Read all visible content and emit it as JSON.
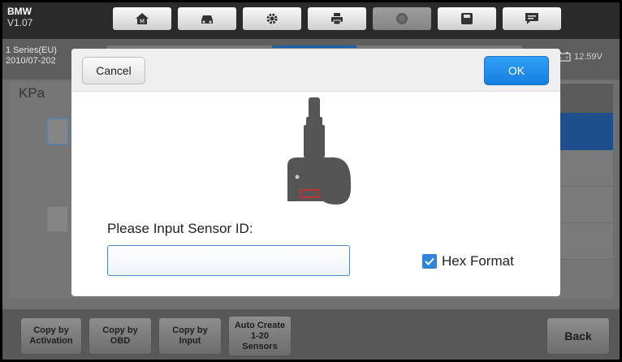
{
  "header": {
    "make": "BMW",
    "version": "V1.07",
    "toolbar_icons": [
      "home-icon",
      "vehicle-icon",
      "settings-icon",
      "print-icon",
      "help-icon",
      "save-icon",
      "message-icon"
    ]
  },
  "info": {
    "vehicle_line1": "1 Series(EU)",
    "vehicle_line2": "2010/07-202",
    "battery_voltage": "12.59V"
  },
  "main": {
    "unit_label": "KPa"
  },
  "dialog": {
    "cancel_label": "Cancel",
    "ok_label": "OK",
    "prompt": "Please Input Sensor ID:",
    "input_value": "",
    "input_placeholder": "",
    "hex_format_label": "Hex Format",
    "hex_format_checked": true
  },
  "bottom": {
    "buttons": [
      {
        "line1": "Copy by",
        "line2": "Activation"
      },
      {
        "line1": "Copy by",
        "line2": "OBD"
      },
      {
        "line1": "Copy by",
        "line2": "Input"
      },
      {
        "line1": "Auto Create",
        "line2": "1-20",
        "line3": "Sensors"
      }
    ],
    "back_label": "Back"
  },
  "colors": {
    "accent": "#1f84e6",
    "highlight_row": "#1d4f8c"
  }
}
